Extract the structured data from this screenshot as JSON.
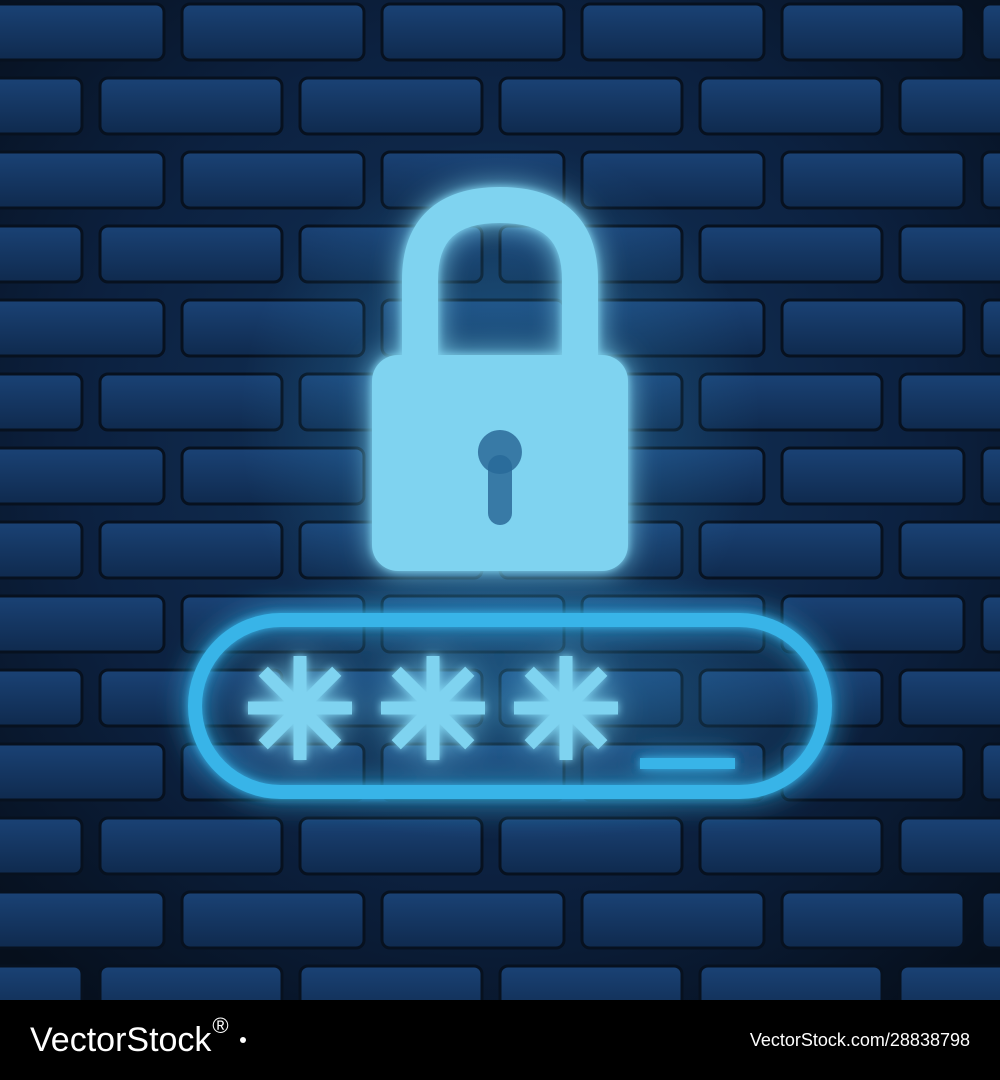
{
  "scene": {
    "background_color": "#0b1a2a",
    "brick_color": "#13305a",
    "neon_color": "#39b4e8",
    "lock_fill_color": "#7fd3f0"
  },
  "illustration": {
    "icon": "padlock-icon",
    "password_field": {
      "masked_characters": [
        "*",
        "*",
        "*"
      ],
      "cursor": "_"
    }
  },
  "footer": {
    "brand_text": "VectorStock",
    "brand_symbol": "®",
    "image_id": "VectorStock.com/28838798"
  }
}
